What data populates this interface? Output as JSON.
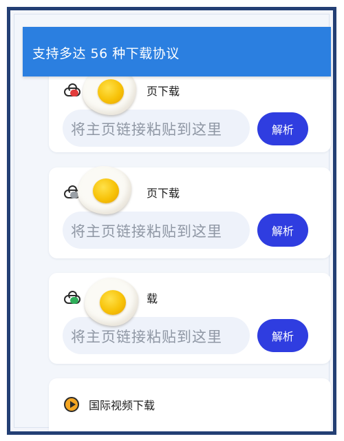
{
  "header": {
    "title": "支持多达 56 种下载协议"
  },
  "cards": [
    {
      "title": "页下载",
      "placeholder": "将主页链接粘贴到这里",
      "button": "解析",
      "cloud_color": "#e23b3b"
    },
    {
      "title": "页下载",
      "placeholder": "将主页链接粘贴到这里",
      "button": "解析",
      "cloud_color": "#9aa0a6"
    },
    {
      "title": "载",
      "placeholder": "将主页链接粘贴到这里",
      "button": "解析",
      "cloud_color": "#2fae5a"
    }
  ],
  "intl": {
    "title": "国际视频下载"
  },
  "colors": {
    "header": "#2b7fe0",
    "button": "#2f3de0",
    "frame": "#233f74"
  }
}
